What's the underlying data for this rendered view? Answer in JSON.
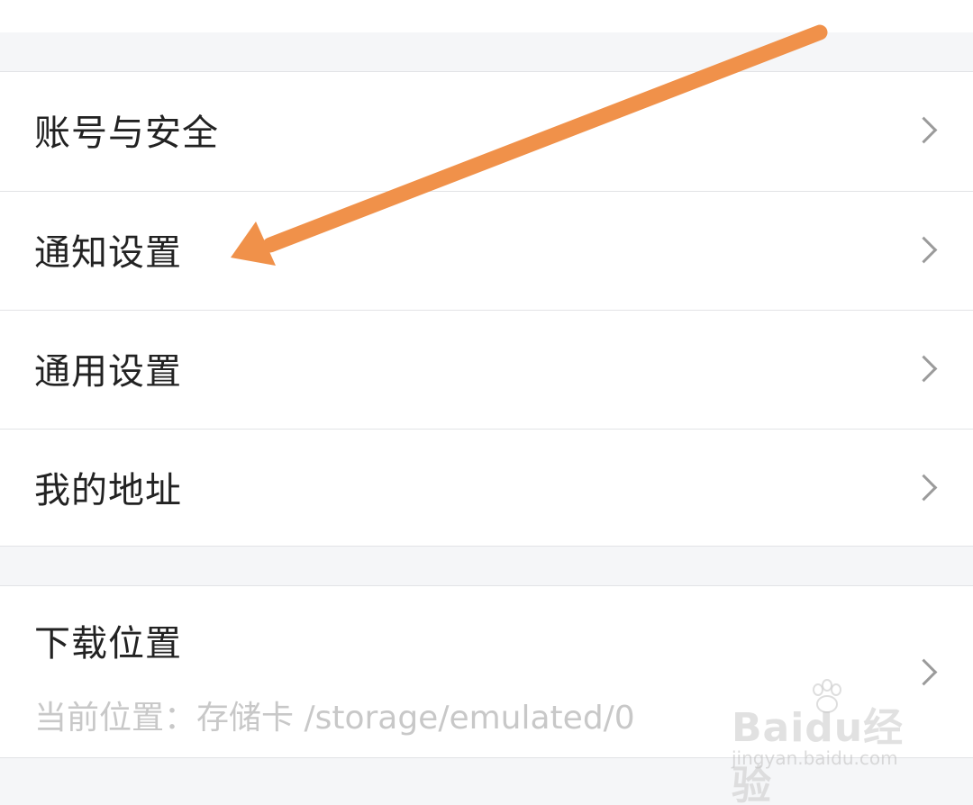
{
  "settings": {
    "group1": [
      {
        "label": "账号与安全"
      },
      {
        "label": "通知设置"
      },
      {
        "label": "通用设置"
      },
      {
        "label": "我的地址"
      }
    ],
    "download": {
      "label": "下载位置",
      "subtitle": "当前位置：存储卡 /storage/emulated/0"
    }
  },
  "annotation": {
    "arrow_color": "#f0914a"
  },
  "watermark": {
    "brand": "Baidu经验",
    "url": "jingyan.baidu.com"
  },
  "icons": {
    "chevron": "chevron-right-icon",
    "watermark_logo": "baidu-paw-icon"
  }
}
